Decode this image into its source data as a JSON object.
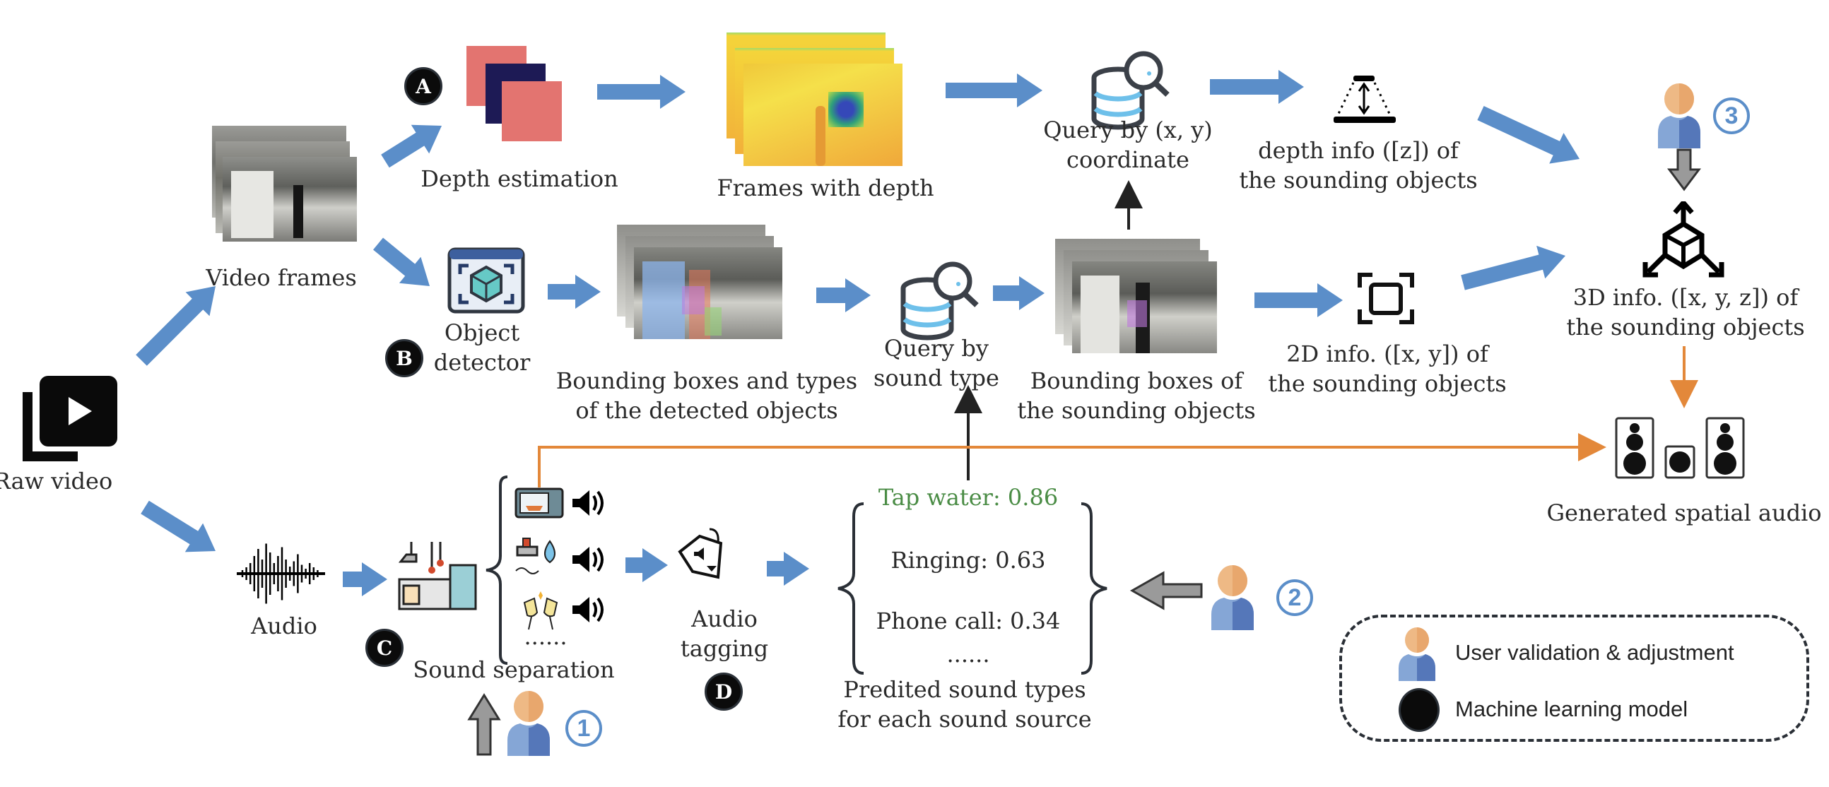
{
  "colors": {
    "flow_arrow": "#5b8ec9",
    "audio_arrow": "#e3883a",
    "user_arrow": "#9a9a9a",
    "badge": "#0b0b0b",
    "highlight_text": "#4a8c45",
    "user_head": "#eeb985",
    "user_body": "#6f93cc",
    "depth_pink": "#e37470",
    "depth_navy": "#1d1a55"
  },
  "nodes": {
    "raw_video": {
      "label": "Raw video",
      "icon": "video-library-icon"
    },
    "video_frames": {
      "label": "Video frames"
    },
    "depth_estimation": {
      "label": "Depth estimation",
      "badge": "A",
      "icon": "depth-model-icon"
    },
    "frames_with_depth": {
      "label": "Frames with depth"
    },
    "query_xy": {
      "label_line1": "Query by (x, y)",
      "label_line2": "coordinate",
      "icon": "database-search-icon"
    },
    "depth_info": {
      "label_line1": "depth info ([z]) of",
      "label_line2": "the sounding objects",
      "icon": "depth-measure-icon"
    },
    "object_detector": {
      "label_line1": "Object",
      "label_line2": "detector",
      "badge": "B",
      "icon": "object-detector-icon"
    },
    "detected_boxes": {
      "label_line1": "Bounding boxes and types",
      "label_line2": "of the detected objects"
    },
    "query_sound": {
      "label_line1": "Query by",
      "label_line2": "sound type",
      "icon": "database-search-icon"
    },
    "sounding_boxes": {
      "label_line1": "Bounding boxes of",
      "label_line2": "the sounding objects"
    },
    "info_2d": {
      "label_line1": "2D info. ([x, y]) of",
      "label_line2": "the sounding objects",
      "icon": "focus-frame-icon"
    },
    "info_3d": {
      "label_line1": "3D info. ([x, y, z]) of",
      "label_line2": "the sounding objects",
      "icon": "3d-axes-icon",
      "user_step": "3"
    },
    "spatial_audio": {
      "label": "Generated spatial audio",
      "icon": "speakers-icon"
    },
    "audio": {
      "label": "Audio",
      "icon": "waveform-icon"
    },
    "sound_separation": {
      "label": "Sound separation",
      "badge": "C",
      "ellipsis": "......",
      "user_step": "1",
      "sources": [
        {
          "icon": "microwave-icon"
        },
        {
          "icon": "tap-water-icon"
        },
        {
          "icon": "glasses-clink-icon"
        }
      ]
    },
    "audio_tagging": {
      "label_line1": "Audio",
      "label_line2": "tagging",
      "badge": "D",
      "icon": "audio-tag-icon"
    },
    "predictions": {
      "items": [
        {
          "label": "Tap water: 0.86",
          "highlight": true
        },
        {
          "label": "Ringing: 0.63",
          "highlight": false
        },
        {
          "label": "Phone call: 0.34",
          "highlight": false
        }
      ],
      "ellipsis": "......",
      "caption_line1": "Predited sound types",
      "caption_line2": "for each sound source",
      "user_step": "2"
    }
  },
  "legend": {
    "items": [
      {
        "label": "User validation & adjustment",
        "icon": "user-icon"
      },
      {
        "label": "Machine learning model",
        "icon": "black-circle-icon"
      }
    ]
  }
}
